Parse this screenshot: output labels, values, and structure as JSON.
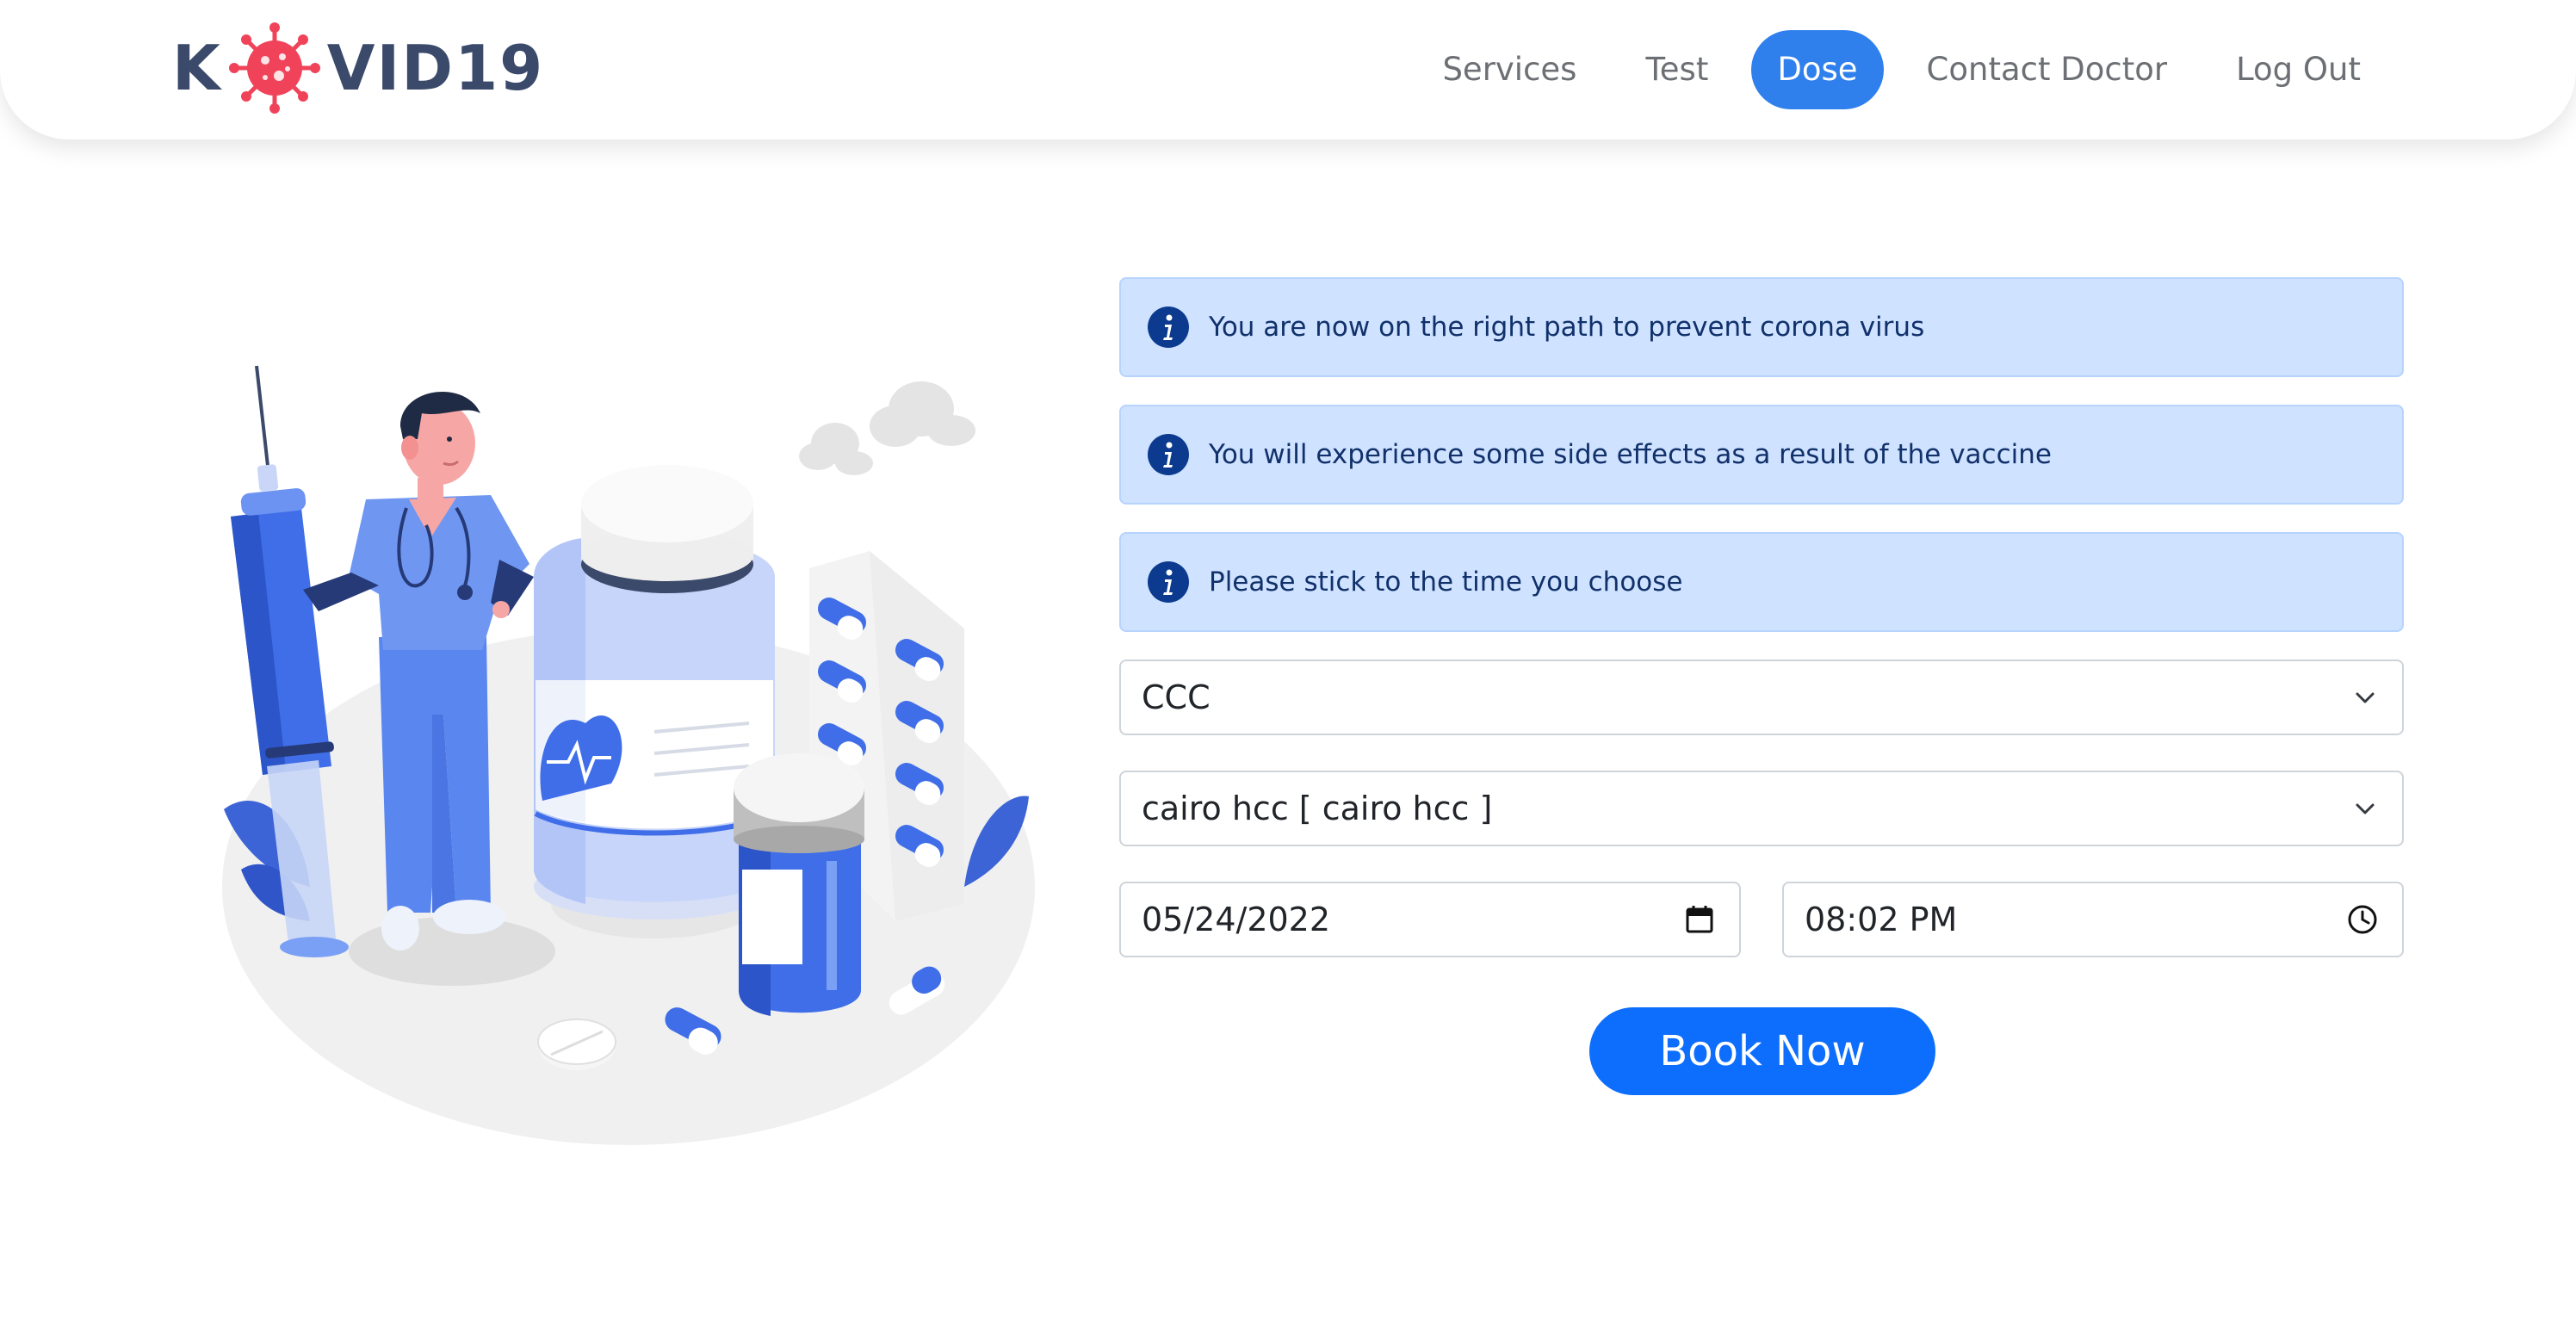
{
  "brand": {
    "logo_left": "K",
    "logo_right": "VID19",
    "virus_color": "#f0435a"
  },
  "nav": {
    "items": [
      {
        "label": "Services"
      },
      {
        "label": "Test"
      },
      {
        "label": "Dose",
        "active": true
      },
      {
        "label": "Contact Doctor"
      },
      {
        "label": "Log Out"
      }
    ],
    "active_color": "#2f80ed"
  },
  "alerts": [
    {
      "icon": "info-icon",
      "text": "You are now on the right path to prevent corona virus"
    },
    {
      "icon": "info-icon",
      "text": "You will experience some side effects as a result of the vaccine"
    },
    {
      "icon": "info-icon",
      "text": "Please stick to the time you choose"
    }
  ],
  "form": {
    "select_one_value": "CCC",
    "select_two_value": "cairo hcc [ cairo hcc ]",
    "date_value": "05/24/2022",
    "time_value": "08:02 PM",
    "book_label": "Book Now"
  },
  "colors": {
    "alert_bg": "#cfe2ff",
    "alert_text": "#11316b",
    "primary": "#0d6efd",
    "illustration_blue": "#4f7df0"
  }
}
